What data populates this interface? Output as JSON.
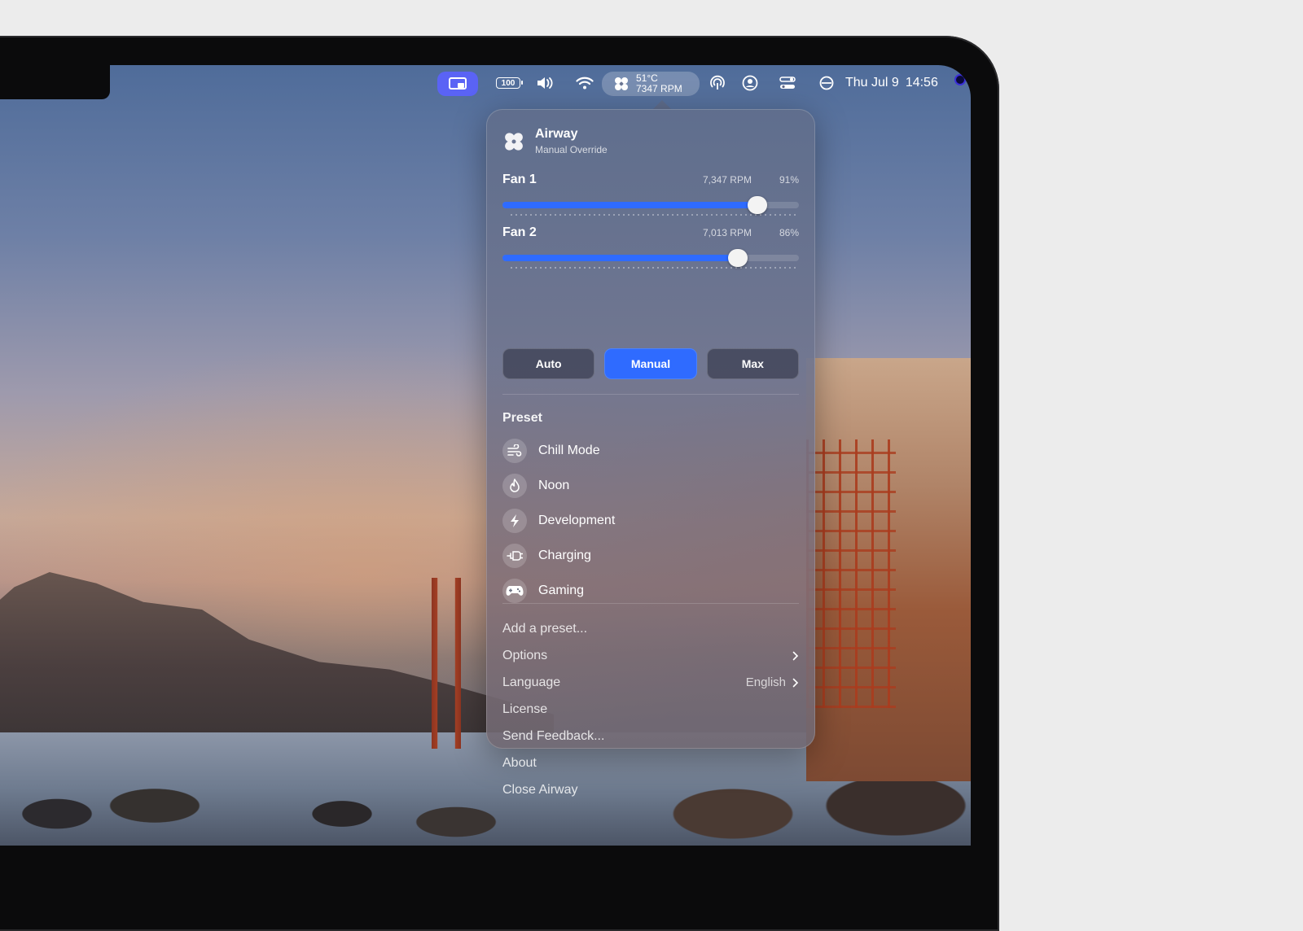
{
  "menubar": {
    "battery_label": "100",
    "fan_temp": "51°C",
    "fan_rpm": "7347 RPM",
    "date": "Thu Jul 9",
    "time": "14:56"
  },
  "panel": {
    "app_name": "Airway",
    "subtitle": "Manual Override",
    "fans": [
      {
        "name": "Fan 1",
        "rpm": "7,347 RPM",
        "percent": "91%",
        "level": 0.86
      },
      {
        "name": "Fan 2",
        "rpm": "7,013 RPM",
        "percent": "86%",
        "level": 0.795
      }
    ],
    "modes": [
      {
        "label": "Auto",
        "active": false
      },
      {
        "label": "Manual",
        "active": true
      },
      {
        "label": "Max",
        "active": false
      }
    ],
    "preset_title": "Preset",
    "presets": [
      {
        "label": "Chill Mode",
        "icon": "wind-icon"
      },
      {
        "label": "Noon",
        "icon": "flame-icon"
      },
      {
        "label": "Development",
        "icon": "bolt-icon"
      },
      {
        "label": "Charging",
        "icon": "plug-icon"
      },
      {
        "label": "Gaming",
        "icon": "gamepad-icon"
      }
    ],
    "menu": {
      "add_preset": "Add a preset...",
      "options": "Options",
      "language": "Language",
      "language_value": "English",
      "license": "License",
      "feedback": "Send Feedback...",
      "about": "About",
      "close": "Close Airway"
    }
  },
  "colors": {
    "accent": "#2f6bff",
    "menubar_active": "#5a63f5"
  }
}
